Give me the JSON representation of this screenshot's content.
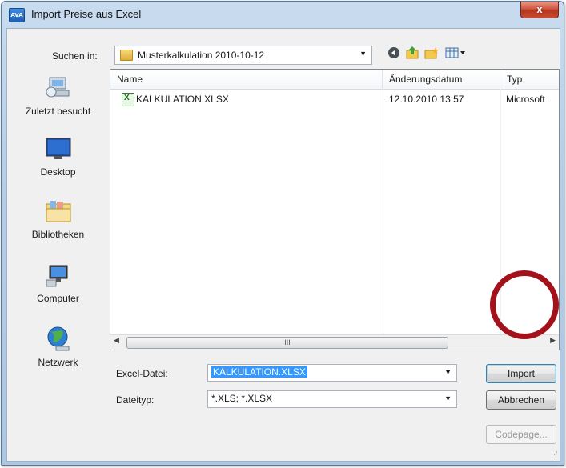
{
  "window": {
    "title": "Import Preise aus Excel",
    "app_icon_text": "AVA",
    "close_label": "x"
  },
  "lookin": {
    "label": "Suchen in:",
    "value": "Musterkalkulation 2010-10-12"
  },
  "toolbar": {
    "icons": [
      "back-icon",
      "up-folder-icon",
      "new-folder-icon",
      "view-menu-icon"
    ]
  },
  "places": [
    {
      "label": "Zuletzt besucht",
      "icon": "recent-places-icon"
    },
    {
      "label": "Desktop",
      "icon": "desktop-icon"
    },
    {
      "label": "Bibliotheken",
      "icon": "libraries-icon"
    },
    {
      "label": "Computer",
      "icon": "computer-icon"
    },
    {
      "label": "Netzwerk",
      "icon": "network-icon"
    }
  ],
  "filelist": {
    "columns": [
      "Name",
      "Änderungsdatum",
      "Typ"
    ],
    "rows": [
      {
        "name": "KALKULATION.XLSX",
        "date": "12.10.2010 13:57",
        "type": "Microsoft"
      }
    ],
    "scrollbar_grip": "III"
  },
  "form": {
    "file_label": "Excel-Datei:",
    "file_value": "KALKULATION.XLSX",
    "type_label": "Dateityp:",
    "type_value": "*.XLS; *.XLSX"
  },
  "buttons": {
    "import": "Import",
    "cancel": "Abbrechen",
    "codepage": "Codepage..."
  },
  "colors": {
    "annotation_ring": "#a3111b",
    "selection": "#3399ff",
    "close_button": "#c84a30"
  }
}
